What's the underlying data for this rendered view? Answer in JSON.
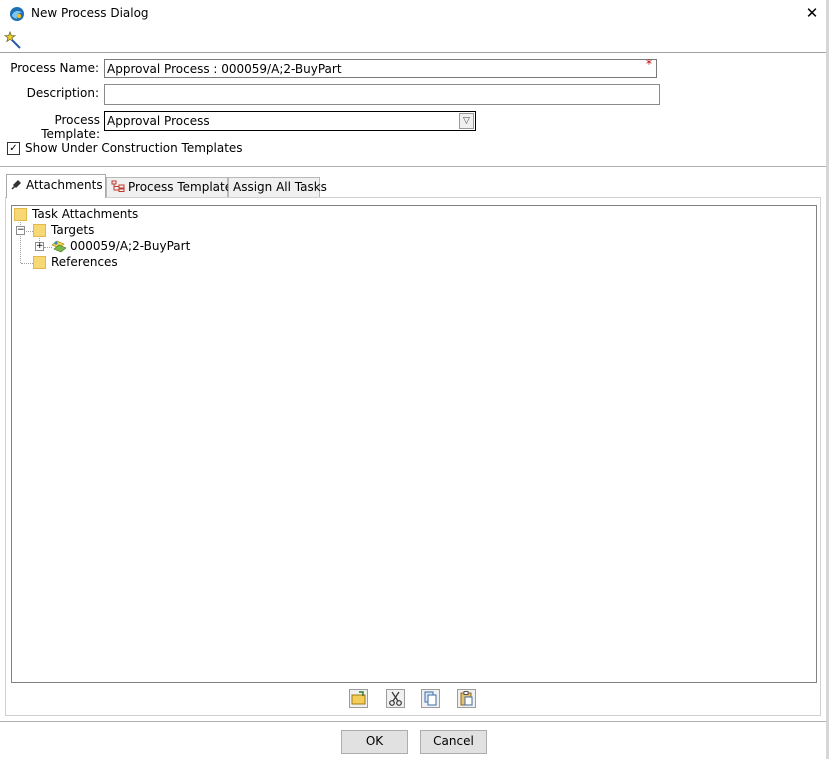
{
  "window": {
    "title": "New Process Dialog",
    "close_glyph": "✕"
  },
  "form": {
    "name_label": "Process Name:",
    "name_value": "Approval Process : 000059/A;2-BuyPart",
    "required_marker": "*",
    "description_label": "Description:",
    "description_value": "",
    "template_label": "Process Template:",
    "template_value": "Approval Process",
    "show_under_construction_label": "Show Under Construction Templates",
    "show_under_construction_checked": true
  },
  "tabs": [
    {
      "label": "Attachments",
      "active": true,
      "icon": "attachment-icon"
    },
    {
      "label": "Process Template",
      "active": false,
      "icon": "process-template-icon"
    },
    {
      "label": "Assign All Tasks",
      "active": false,
      "icon": ""
    }
  ],
  "tree": {
    "root": "Task Attachments",
    "targets": "Targets",
    "target_item": "000059/A;2-BuyPart",
    "references": "References"
  },
  "actions": [
    "open-folder-icon",
    "cut-icon",
    "copy-icon",
    "paste-icon"
  ],
  "buttons": {
    "ok": "OK",
    "cancel": "Cancel"
  }
}
